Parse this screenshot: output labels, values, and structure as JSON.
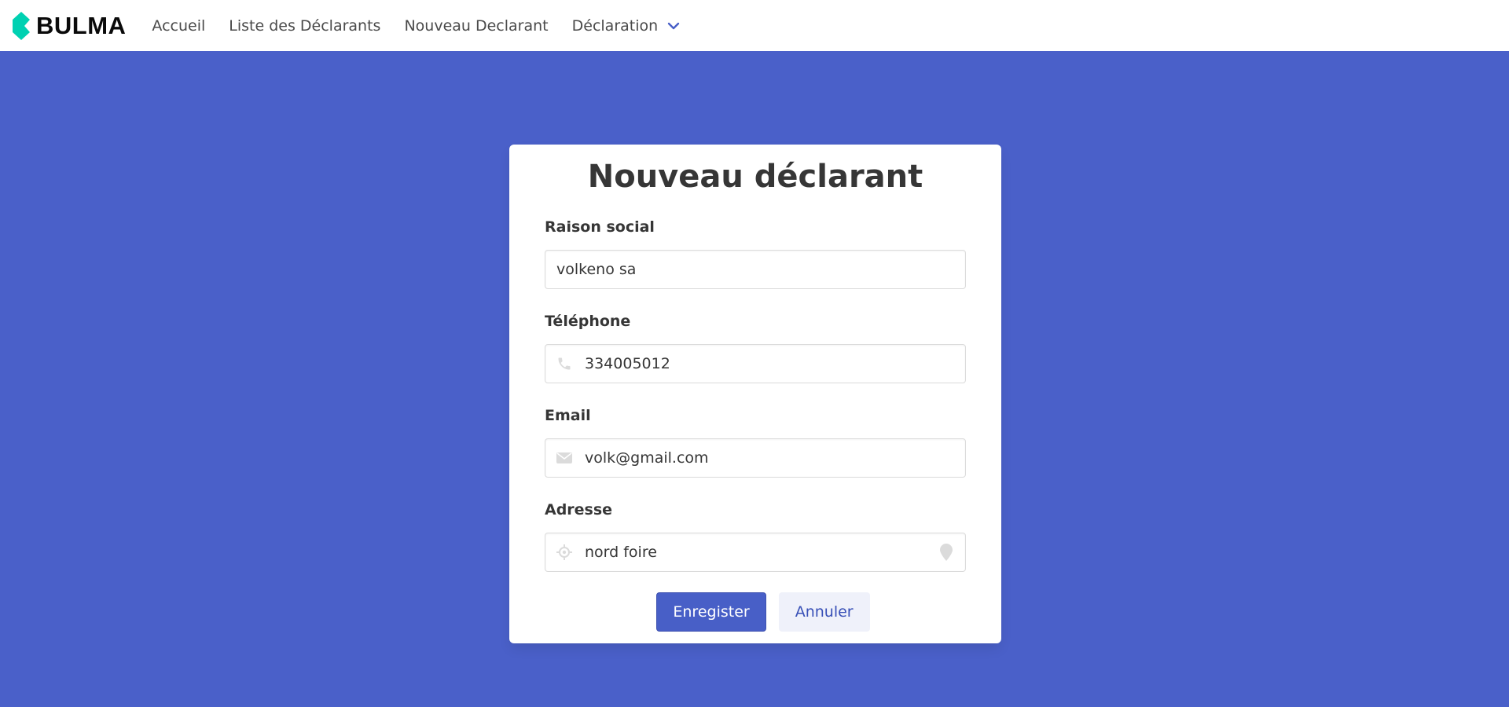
{
  "brand": {
    "name": "BULMA",
    "logo_color": "#00d1b2"
  },
  "nav": {
    "items": [
      {
        "label": "Accueil"
      },
      {
        "label": "Liste des Déclarants"
      },
      {
        "label": "Nouveau Declarant"
      },
      {
        "label": "Déclaration",
        "icon": "chevron-down-icon"
      }
    ]
  },
  "form": {
    "title": "Nouveau déclarant",
    "fields": {
      "raison_social": {
        "label": "Raison social",
        "value": "volkeno sa"
      },
      "telephone": {
        "label": "Téléphone",
        "value": "334005012",
        "icon": "phone-icon"
      },
      "email": {
        "label": "Email",
        "value": "volk@gmail.com",
        "icon": "envelope-icon"
      },
      "adresse": {
        "label": "Adresse",
        "value": "nord foire",
        "icon": "crosshairs-icon",
        "right_icon": "map-marker-icon"
      }
    },
    "buttons": {
      "submit": "Enregister",
      "cancel": "Annuler"
    }
  },
  "colors": {
    "background": "#4a60c9",
    "primary": "#485fc7",
    "light_button": "#eff1fa",
    "icon_gray": "#dbdbdb"
  }
}
